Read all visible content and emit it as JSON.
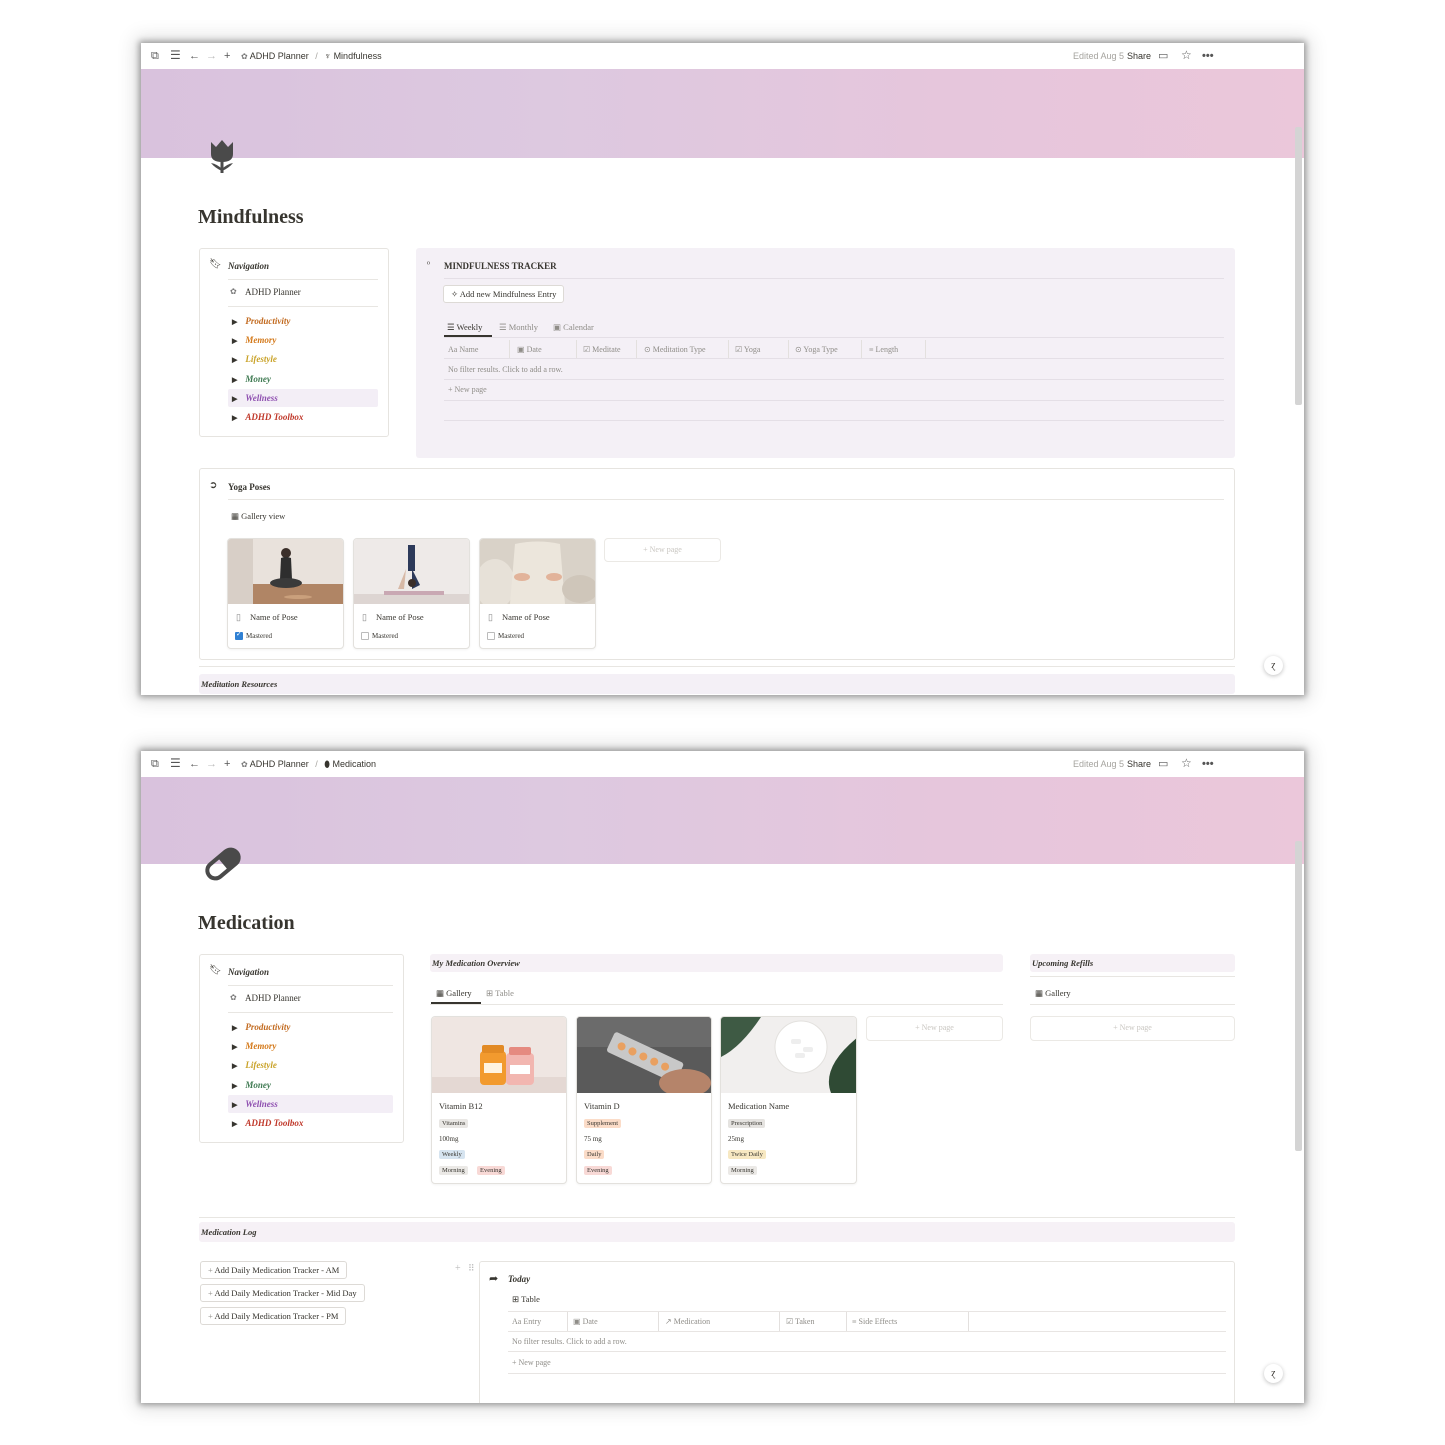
{
  "colors": {
    "productivity": "#c26a1f",
    "memory": "#d4791a",
    "lifestyle": "#c9a227",
    "money": "#3f7a52",
    "wellness": "#8e4fb0",
    "toolbox": "#c0392b",
    "cover_left": "#d9c2dd",
    "cover_right": "#ebc7da"
  },
  "topbar": {
    "workspace": "ADHD Planner",
    "separator": "/",
    "edited": "Edited Aug 5",
    "share": "Share",
    "icons": [
      "sidebar-toggle-icon",
      "menu-icon",
      "back-arrow-icon",
      "forward-arrow-icon",
      "plus-icon",
      "comment-icon",
      "star-icon",
      "more-icon"
    ]
  },
  "navigation": {
    "title": "Navigation",
    "planner": "ADHD Planner",
    "items": [
      "Productivity",
      "Memory",
      "Lifestyle",
      "Money",
      "Wellness",
      "ADHD Toolbox"
    ]
  },
  "mindfulness": {
    "crumb": "Mindfulness",
    "title": "Mindfulness",
    "tracker": {
      "title": "MINDFULNESS TRACKER",
      "add_button": "Add new Mindfulness Entry",
      "tabs": [
        "Weekly",
        "Monthly",
        "Calendar"
      ],
      "columns": [
        "Name",
        "Date",
        "Meditate",
        "Meditation Type",
        "Yoga",
        "Yoga Type",
        "Length"
      ],
      "column_icons": [
        "Aa",
        "▣",
        "☑",
        "⊙",
        "☑",
        "⊙",
        "≡"
      ],
      "empty": "No filter results. Click to add a row.",
      "new_page": "New page"
    },
    "yoga": {
      "title": "Yoga Poses",
      "view": "Gallery view",
      "cards": [
        {
          "title": "Name of Pose",
          "prop": "Mastered",
          "mastered": true
        },
        {
          "title": "Name of Pose",
          "prop": "Mastered",
          "mastered": false
        },
        {
          "title": "Name of Pose",
          "prop": "Mastered",
          "mastered": false
        }
      ],
      "new_page": "New page"
    },
    "meditation_resources": "Meditation Resources"
  },
  "medication": {
    "crumb": "Medication",
    "title": "Medication",
    "overview": {
      "title": "My Medication Overview",
      "tabs": [
        "Gallery",
        "Table"
      ],
      "cards": [
        {
          "name": "Vitamin B12",
          "type": "Vitamins",
          "dose": "100mg",
          "freq": "Weekly",
          "time1": "Morning",
          "time2": "Evening"
        },
        {
          "name": "Vitamin D",
          "type": "Supplement",
          "dose": "75 mg",
          "freq": "Daily",
          "time1": "Evening",
          "time2": ""
        },
        {
          "name": "Medication Name",
          "type": "Prescription",
          "dose": "25mg",
          "freq": "Twice Daily",
          "time1": "Morning",
          "time2": ""
        }
      ],
      "new_page": "New page"
    },
    "refills": {
      "title": "Upcoming Refills",
      "view": "Gallery",
      "new_page": "New page"
    },
    "log": {
      "title": "Medication Log",
      "buttons": [
        "Add Daily Medication Tracker - AM",
        "Add Daily Medication Tracker - Mid Day",
        "Add Daily Medication Tracker - PM"
      ],
      "today": "Today",
      "view": "Table",
      "columns": [
        "Entry",
        "Date",
        "Medication",
        "Taken",
        "Side Effects"
      ],
      "column_icons": [
        "Aa",
        "▣",
        "↗",
        "☑",
        "≡"
      ],
      "empty": "No filter results. Click to add a row.",
      "new_page": "New page"
    }
  }
}
